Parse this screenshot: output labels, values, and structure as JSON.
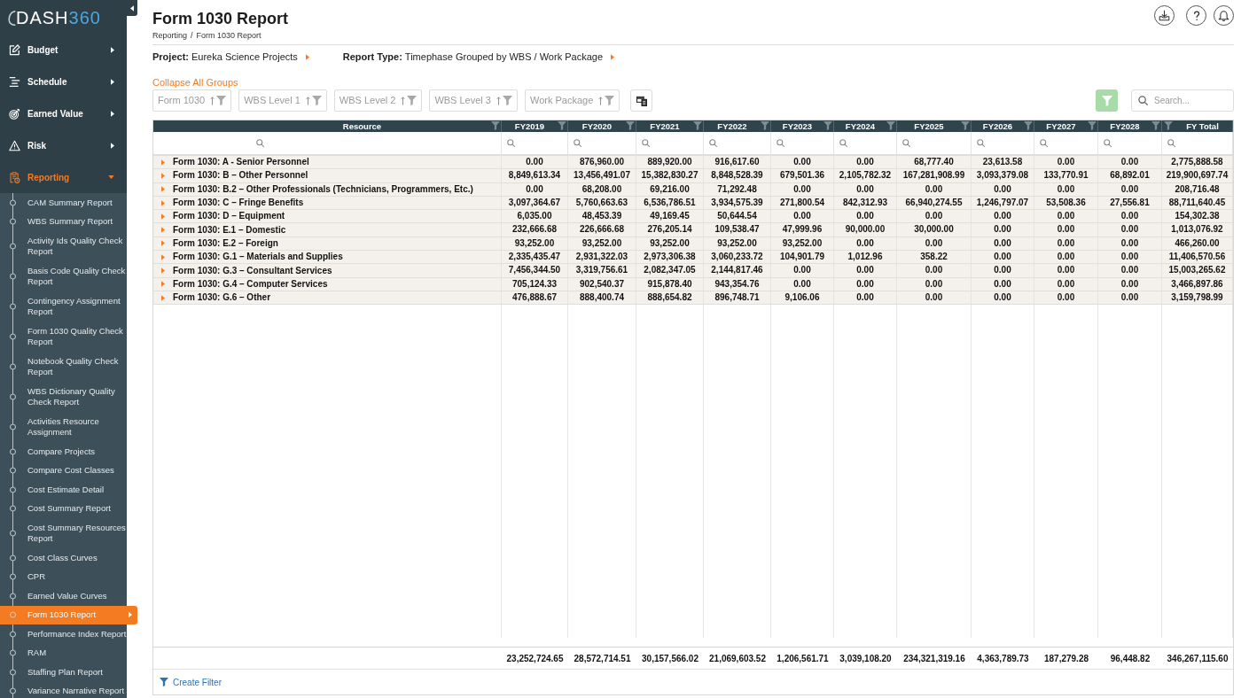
{
  "sidebar": {
    "logo": {
      "text": "DASH",
      "accent": "360"
    },
    "nav": [
      {
        "label": "Budget",
        "expanded": false
      },
      {
        "label": "Schedule",
        "expanded": false
      },
      {
        "label": "Earned Value",
        "expanded": false
      },
      {
        "label": "Risk",
        "expanded": false
      },
      {
        "label": "Reporting",
        "expanded": true,
        "children": [
          {
            "label": "CAM Summary Report",
            "selected": false
          },
          {
            "label": "WBS Summary Report",
            "selected": false
          },
          {
            "label": "Activity Ids Quality Check Report",
            "selected": false
          },
          {
            "label": "Basis Code Quality Check Report",
            "selected": false
          },
          {
            "label": "Contingency Assignment Report",
            "selected": false
          },
          {
            "label": "Form 1030 Quality Check Report",
            "selected": false
          },
          {
            "label": "Notebook Quality Check Report",
            "selected": false
          },
          {
            "label": "WBS Dictionary Quality Check Report",
            "selected": false
          },
          {
            "label": "Activities Resource Assignment",
            "selected": false
          },
          {
            "label": "Compare Projects",
            "selected": false
          },
          {
            "label": "Compare Cost Classes",
            "selected": false
          },
          {
            "label": "Cost Estimate Detail",
            "selected": false
          },
          {
            "label": "Cost Summary Report",
            "selected": false
          },
          {
            "label": "Cost Summary Resources Report",
            "selected": false
          },
          {
            "label": "Cost Class Curves",
            "selected": false
          },
          {
            "label": "CPR",
            "selected": false
          },
          {
            "label": "Earned Value Curves",
            "selected": false
          },
          {
            "label": "Form 1030 Report",
            "selected": true
          },
          {
            "label": "Performance Index Report",
            "selected": false
          },
          {
            "label": "RAM",
            "selected": false
          },
          {
            "label": "Staffing Plan Report",
            "selected": false
          },
          {
            "label": "Variance Narrative Report",
            "selected": false
          }
        ]
      }
    ]
  },
  "header": {
    "title": "Form 1030 Report",
    "breadcrumb": {
      "items": [
        "Reporting",
        "Form 1030 Report"
      ],
      "separator": "/"
    }
  },
  "context": [
    {
      "label": "Project:",
      "value": "Eureka Science Projects"
    },
    {
      "label": "Report Type:",
      "value": "Timephase Grouped by WBS / Work Package"
    }
  ],
  "toolbar": {
    "collapse_link": "Collapse All Groups",
    "group_by": [
      "Form 1030",
      "WBS Level 1",
      "WBS Level 2",
      "WBS Level 3",
      "Work Package"
    ],
    "search": {
      "placeholder": "Search..."
    }
  },
  "table": {
    "columns": [
      "Resource",
      "FY2019",
      "FY2020",
      "FY2021",
      "FY2022",
      "FY2023",
      "FY2024",
      "FY2025",
      "FY2026",
      "FY2027",
      "FY2028",
      "FY Total"
    ],
    "rows": [
      {
        "resource": "Form 1030: A - Senior Personnel",
        "expanded": false,
        "values": [
          "0.00",
          "876,960.00",
          "889,920.00",
          "916,617.60",
          "0.00",
          "0.00",
          "68,777.40",
          "23,613.58",
          "0.00",
          "0.00",
          "2,775,888.58"
        ]
      },
      {
        "resource": "Form 1030: B – Other Personnel",
        "expanded": false,
        "values": [
          "8,849,613.34",
          "13,456,491.07",
          "15,382,830.27",
          "8,848,528.39",
          "679,501.36",
          "2,105,782.32",
          "167,281,908.99",
          "3,093,379.08",
          "133,770.91",
          "68,892.01",
          "219,900,697.74"
        ]
      },
      {
        "resource": "Form 1030: B.2 – Other Professionals (Technicians, Programmers, Etc.)",
        "expanded": false,
        "values": [
          "0.00",
          "68,208.00",
          "69,216.00",
          "71,292.48",
          "0.00",
          "0.00",
          "0.00",
          "0.00",
          "0.00",
          "0.00",
          "208,716.48"
        ]
      },
      {
        "resource": "Form 1030: C – Fringe Benefits",
        "expanded": false,
        "values": [
          "3,097,364.67",
          "5,760,663.63",
          "6,536,786.51",
          "3,934,575.39",
          "271,800.54",
          "842,312.93",
          "66,940,274.55",
          "1,246,797.07",
          "53,508.36",
          "27,556.81",
          "88,711,640.45"
        ]
      },
      {
        "resource": "Form 1030: D – Equipment",
        "expanded": false,
        "values": [
          "6,035.00",
          "48,453.39",
          "49,169.45",
          "50,644.54",
          "0.00",
          "0.00",
          "0.00",
          "0.00",
          "0.00",
          "0.00",
          "154,302.38"
        ]
      },
      {
        "resource": "Form 1030: E.1 – Domestic",
        "expanded": false,
        "values": [
          "232,666.68",
          "226,666.68",
          "276,205.14",
          "109,538.47",
          "47,999.96",
          "90,000.00",
          "30,000.00",
          "0.00",
          "0.00",
          "0.00",
          "1,013,076.92"
        ]
      },
      {
        "resource": "Form 1030: E.2 – Foreign",
        "expanded": false,
        "values": [
          "93,252.00",
          "93,252.00",
          "93,252.00",
          "93,252.00",
          "93,252.00",
          "0.00",
          "0.00",
          "0.00",
          "0.00",
          "0.00",
          "466,260.00"
        ]
      },
      {
        "resource": "Form 1030: G.1 – Materials and Supplies",
        "expanded": false,
        "values": [
          "2,335,435.47",
          "2,931,322.03",
          "2,973,306.38",
          "3,060,233.72",
          "104,901.79",
          "1,012.96",
          "358.22",
          "0.00",
          "0.00",
          "0.00",
          "11,406,570.56"
        ]
      },
      {
        "resource": "Form 1030: G.3 – Consultant Services",
        "expanded": false,
        "values": [
          "7,456,344.50",
          "3,319,756.61",
          "2,082,347.05",
          "2,144,817.46",
          "0.00",
          "0.00",
          "0.00",
          "0.00",
          "0.00",
          "0.00",
          "15,003,265.62"
        ]
      },
      {
        "resource": "Form 1030: G.4 – Computer Services",
        "expanded": false,
        "values": [
          "705,124.33",
          "902,540.37",
          "915,878.40",
          "943,354.76",
          "0.00",
          "0.00",
          "0.00",
          "0.00",
          "0.00",
          "0.00",
          "3,466,897.86"
        ]
      },
      {
        "resource": "Form 1030: G.6 – Other",
        "expanded": false,
        "values": [
          "476,888.67",
          "888,400.74",
          "888,654.82",
          "896,748.71",
          "9,106.06",
          "0.00",
          "0.00",
          "0.00",
          "0.00",
          "0.00",
          "3,159,798.99"
        ]
      }
    ],
    "totals": [
      "23,252,724.65",
      "28,572,714.51",
      "30,157,566.02",
      "21,069,603.52",
      "1,206,561.71",
      "3,039,108.20",
      "234,321,319.16",
      "4,363,789.73",
      "187,279.28",
      "96,448.82",
      "346,267,115.60"
    ]
  },
  "footer": {
    "create_filter": "Create Filter"
  }
}
